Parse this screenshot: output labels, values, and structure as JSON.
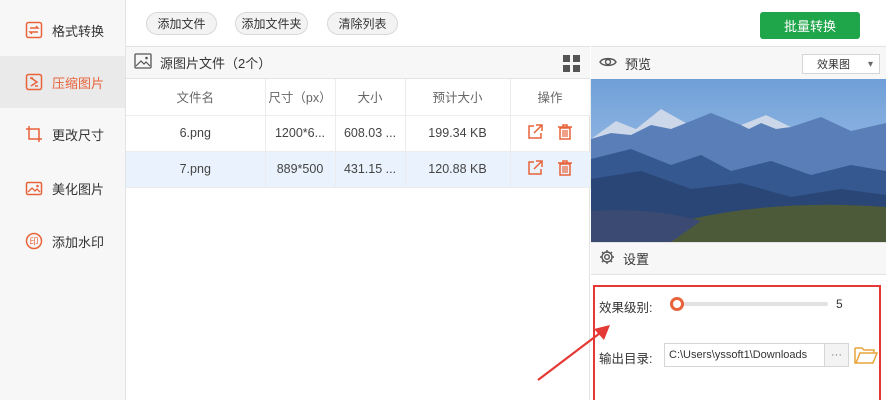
{
  "sidebar": {
    "items": [
      {
        "label": "格式转换",
        "icon": "format-convert-icon"
      },
      {
        "label": "压缩图片",
        "icon": "compress-image-icon",
        "active": true
      },
      {
        "label": "更改尺寸",
        "icon": "resize-icon"
      },
      {
        "label": "美化图片",
        "icon": "beautify-image-icon"
      },
      {
        "label": "添加水印",
        "icon": "watermark-icon"
      }
    ]
  },
  "toolbar": {
    "add_file": "添加文件",
    "add_folder": "添加文件夹",
    "clear_list": "清除列表",
    "batch_convert": "批量转换"
  },
  "file_panel": {
    "title": "源图片文件（2个）",
    "columns": [
      "文件名",
      "尺寸（px）",
      "大小",
      "预计大小",
      "操作"
    ],
    "rows": [
      {
        "name": "6.png",
        "size_px": "1200*6...",
        "size": "608.03 ...",
        "estimated": "199.34 KB"
      },
      {
        "name": "7.png",
        "size_px": "889*500",
        "size": "431.15 ...",
        "estimated": "120.88 KB",
        "selected": true
      }
    ]
  },
  "preview": {
    "title": "预览",
    "mode_selected": "效果图"
  },
  "settings": {
    "title": "设置",
    "effect_level_label": "效果级别:",
    "effect_level_value": "5",
    "effect_level_fraction": 0.0,
    "output_dir_label": "输出目录:",
    "output_dir_value": "C:\\Users\\yssoft1\\Downloads",
    "browse_label": "···"
  },
  "colors": {
    "accent": "#e8623a",
    "batch_button": "#1fa54a",
    "highlight_box": "#e53935",
    "selected_row": "#eaf3fd"
  }
}
